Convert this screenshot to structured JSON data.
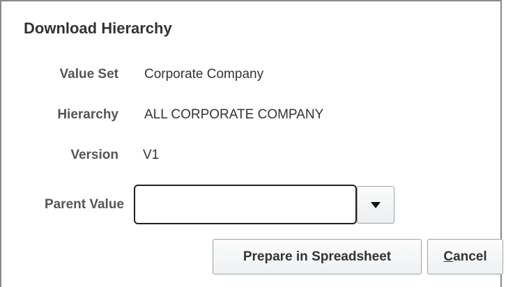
{
  "dialog": {
    "title": "Download Hierarchy"
  },
  "fields": {
    "value_set": {
      "label": "Value Set",
      "value": "Corporate Company"
    },
    "hierarchy": {
      "label": "Hierarchy",
      "value": "ALL CORPORATE COMPANY"
    },
    "version": {
      "label": "Version",
      "value": "V1"
    },
    "parent_value": {
      "label": "Parent Value",
      "value": "",
      "placeholder": ""
    }
  },
  "buttons": {
    "prepare_label": "Prepare in Spreadsheet",
    "cancel_accesskey": "C",
    "cancel_rest": "ancel"
  },
  "icons": {
    "dropdown": "triangle-down-icon"
  }
}
